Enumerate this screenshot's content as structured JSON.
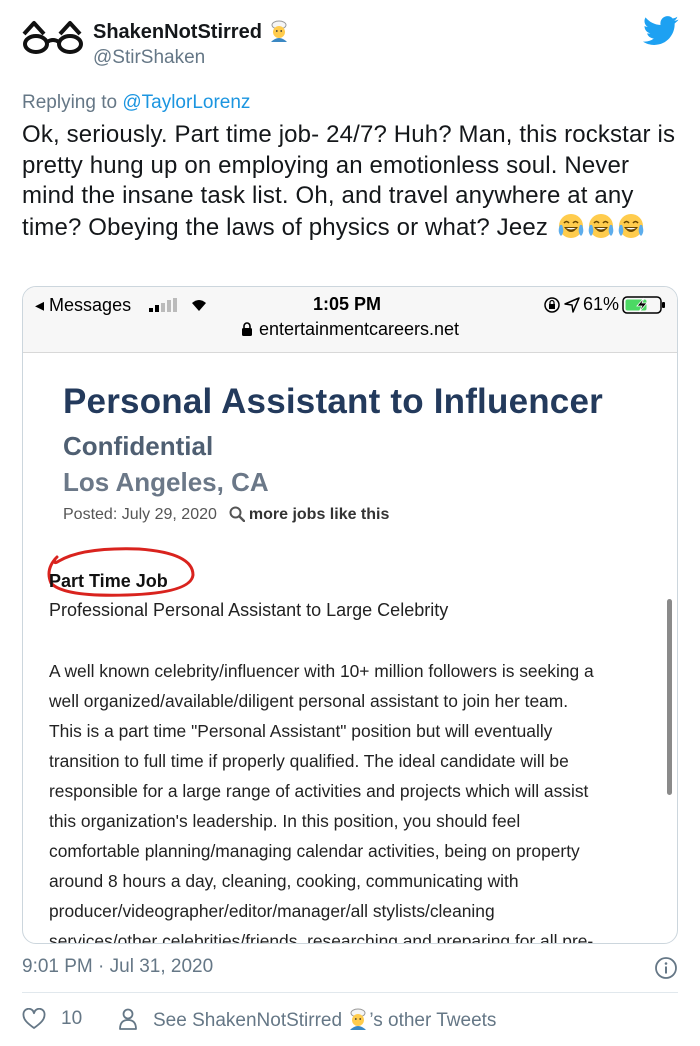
{
  "tweet": {
    "user_name": "ShakenNotStirred",
    "user_handle": "@StirShaken",
    "reply_prefix": "Replying to",
    "reply_to": "@TaylorLorenz",
    "text": "Ok, seriously. Part time job- 24/7? Huh? Man, this rockstar is pretty hung up on employing an emotionless soul. Never mind the insane task list. Oh, and travel anywhere at any time? Obeying the laws of physics or what? Jeez",
    "text_emoji": "face-with-tears-of-joy-icon",
    "text_emoji_count": 3,
    "timestamp": "9:01 PM · Jul 31, 2020",
    "like_count": "10",
    "see_others_prefix": "See ShakenNotStirred",
    "see_others_suffix": "’s other Tweets",
    "accent_color": "#1b95e0",
    "muted_color": "#657786"
  },
  "screenshot": {
    "status_bar": {
      "back_label": "◂ Messages",
      "time": "1:05 PM",
      "battery": "61%"
    },
    "url": "entertainmentcareers.net",
    "job_title": "Personal Assistant to Influencer",
    "company": "Confidential",
    "location": "Los Angeles, CA",
    "posted": "Posted: July 29, 2020",
    "more_jobs": "more jobs like this",
    "job_type": "Part Time Job",
    "subtitle": "Professional Personal Assistant to Large Celebrity",
    "description_lines": [
      "A well known celebrity/influencer with 10+ million followers is seeking a",
      "well organized/available/diligent personal assistant to join her team.",
      "This is a part time \"Personal Assistant\" position but will eventually",
      "transition to full time if properly qualified. The ideal candidate will be",
      "responsible for a large range of activities and projects which will assist",
      "this organization's leadership. In this position, you should feel",
      "comfortable planning/managing calendar activities, being on property",
      "around 8 hours a day, cleaning, cooking, communicating with",
      "producer/videographer/editor/manager/all stylists/cleaning",
      "services/other celebrities/friends, researching and preparing for all pre-"
    ],
    "title_color": "#233a5c",
    "circle_color": "#d9231e"
  }
}
